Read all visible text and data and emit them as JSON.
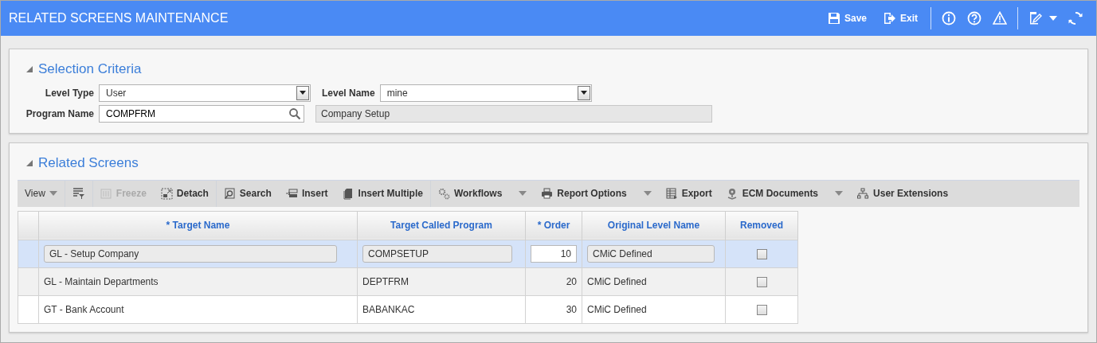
{
  "window": {
    "title": "RELATED SCREENS MAINTENANCE"
  },
  "header_actions": [
    {
      "label": "Save"
    },
    {
      "label": "Exit"
    }
  ],
  "selection_criteria": {
    "title": "Selection Criteria",
    "expanded": true,
    "level_type": {
      "label": "Level Type",
      "value": "User"
    },
    "level_name": {
      "label": "Level Name",
      "value": "mine"
    },
    "program_name": {
      "label": "Program Name",
      "value": "COMPFRM",
      "description": "Company Setup"
    }
  },
  "related_screens": {
    "title": "Related Screens",
    "expanded": true,
    "toolbar": [
      {
        "kind": "menu",
        "label": "View",
        "disabled": false,
        "dropdown": true
      },
      {
        "kind": "icon",
        "disabled": false,
        "dropdown": false
      },
      {
        "kind": "button",
        "label": "Freeze",
        "disabled": true,
        "dropdown": false
      },
      {
        "kind": "button",
        "label": "Detach",
        "disabled": false,
        "dropdown": false
      },
      {
        "kind": "button",
        "label": "Search",
        "disabled": false,
        "dropdown": false
      },
      {
        "kind": "button",
        "label": "Insert",
        "disabled": false,
        "dropdown": false
      },
      {
        "kind": "button",
        "label": "Insert Multiple",
        "disabled": false,
        "dropdown": false
      },
      {
        "kind": "button",
        "label": "Workflows",
        "disabled": false,
        "dropdown": true
      },
      {
        "kind": "button",
        "label": "Report Options",
        "disabled": false,
        "dropdown": true
      },
      {
        "kind": "button",
        "label": "Export",
        "disabled": false,
        "dropdown": false
      },
      {
        "kind": "button",
        "label": "ECM Documents",
        "disabled": false,
        "dropdown": true
      },
      {
        "kind": "button",
        "label": "User Extensions",
        "disabled": false,
        "dropdown": false
      }
    ],
    "columns": [
      "* Target Name",
      "Target Called Program",
      "* Order",
      "Original Level Name",
      "Removed"
    ],
    "rows": [
      {
        "selected": true,
        "target_name": "GL - Setup Company",
        "target_called_program": "COMPSETUP",
        "order": "10",
        "original_level_name": "CMiC Defined",
        "removed": false
      },
      {
        "selected": false,
        "target_name": "GL - Maintain Departments",
        "target_called_program": "DEPTFRM",
        "order": "20",
        "original_level_name": "CMiC Defined",
        "removed": false
      },
      {
        "selected": false,
        "target_name": "GT - Bank Account",
        "target_called_program": "BABANKAC",
        "order": "30",
        "original_level_name": "CMiC Defined",
        "removed": false
      }
    ]
  }
}
